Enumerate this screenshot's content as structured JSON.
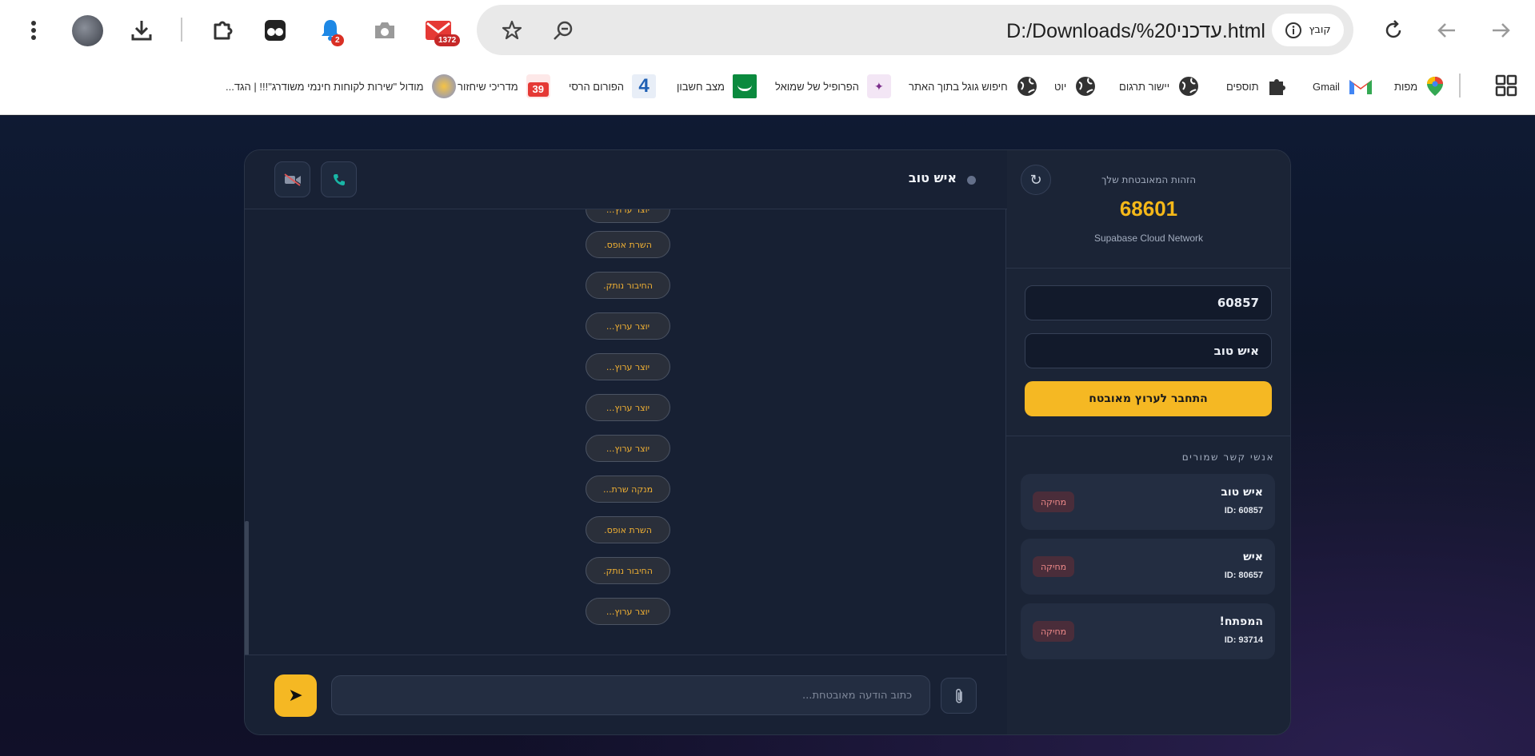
{
  "browser": {
    "url": "D:/Downloads/%20עדכני.html",
    "site_chip": "קובץ",
    "notifications_badge": "2",
    "mail_badge": "1372",
    "bookmarks": [
      {
        "label": "מפות"
      },
      {
        "label": "Gmail"
      },
      {
        "label": "תוספים"
      },
      {
        "label": "יישור תרגום"
      },
      {
        "label": "יוט"
      },
      {
        "label": "חיפוש גוגל בתוך האתר"
      },
      {
        "label": "הפרופיל של שמואל"
      },
      {
        "label": "מצב חשבון"
      },
      {
        "label": "הפורום הרסי"
      },
      {
        "label": "מדריכי שיחזור"
      },
      {
        "label": "מודול \"שירות לקוחות חינמי משודרג\"!!! | הגד..."
      }
    ]
  },
  "sidebar": {
    "identity_label": "הזהות המאובטחת שלך",
    "identity_id": "68601",
    "network": "Supabase Cloud Network",
    "refresh_icon": "↻",
    "target_id_value": "60857",
    "target_name_value": "איש טוב",
    "connect_label": "התחבר לערוץ מאובטח",
    "contacts_title": "אנשי קשר שמורים",
    "contacts": [
      {
        "name": "איש טוב",
        "id": "ID: 60857",
        "delete": "מחיקה"
      },
      {
        "name": "איש",
        "id": "ID: 80657",
        "delete": "מחיקה"
      },
      {
        "name": "המפתח!",
        "id": "ID: 93714",
        "delete": "מחיקה"
      }
    ]
  },
  "chat": {
    "peer_name": "איש טוב",
    "messages": [
      "יוצר ערוץ...",
      "השרת אופס.",
      "החיבור נותק.",
      "יוצר ערוץ...",
      "יוצר ערוץ...",
      "יוצר ערוץ...",
      "יוצר ערוץ...",
      "מנקה שרת...",
      "השרת אופס.",
      "החיבור נותק.",
      "יוצר ערוץ..."
    ],
    "input_placeholder": "כתוב הודעה מאובטחת...",
    "send_icon": "➤"
  },
  "colors": {
    "accent": "#f5b823",
    "panel": "#172033",
    "danger_text": "#f08a8a"
  }
}
